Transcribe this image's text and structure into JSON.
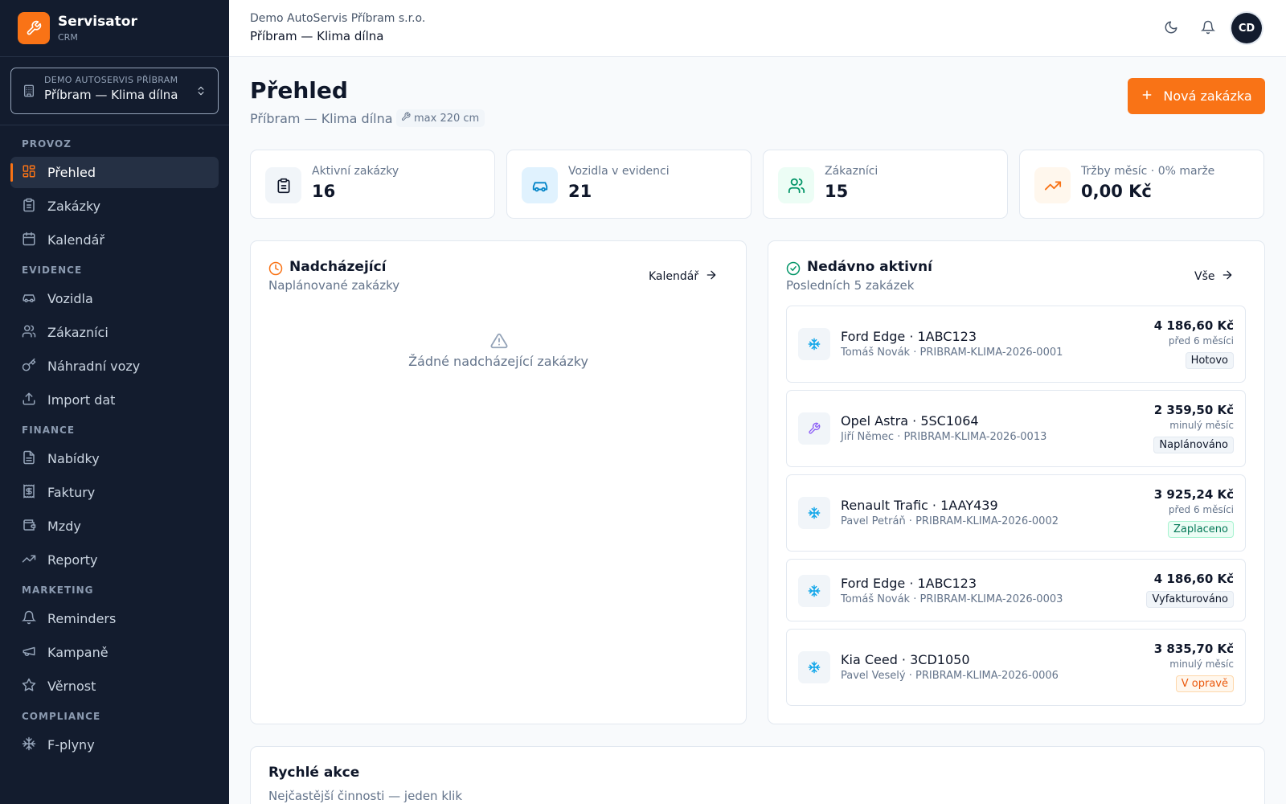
{
  "app": {
    "name": "Servisator",
    "sub": "CRM"
  },
  "tenant": {
    "org": "DEMO AUTOSERVIS PŘÍBRAM",
    "name": "Příbram — Klima dílna"
  },
  "nav": {
    "sections": {
      "provoz": "PROVOZ",
      "evidence": "EVIDENCE",
      "finance": "FINANCE",
      "marketing": "MARKETING",
      "compliance": "COMPLIANCE"
    },
    "items": {
      "prehled": "Přehled",
      "zakazky": "Zakázky",
      "kalendar": "Kalendář",
      "vozidla": "Vozidla",
      "zakaznici": "Zákazníci",
      "nahradni": "Náhradní vozy",
      "import": "Import dat",
      "nabidky": "Nabídky",
      "faktury": "Faktury",
      "mzdy": "Mzdy",
      "reporty": "Reporty",
      "reminders": "Reminders",
      "kampane": "Kampaně",
      "vernost": "Věrnost",
      "fplyny": "F-plyny"
    }
  },
  "topbar": {
    "org": "Demo AutoServis Příbram s.r.o.",
    "location": "Příbram — Klima dílna",
    "avatar": "CD"
  },
  "page": {
    "title": "Přehled",
    "subtitle": "Příbram — Klima dílna",
    "badge": "max 220 cm",
    "new_button": "Nová zakázka"
  },
  "stats": [
    {
      "label": "Aktivní zakázky",
      "value": "16"
    },
    {
      "label": "Vozidla v evidenci",
      "value": "21"
    },
    {
      "label": "Zákazníci",
      "value": "15"
    },
    {
      "label": "Tržby měsíc · 0% marže",
      "value": "0,00 Kč"
    }
  ],
  "upcoming": {
    "title": "Nadcházející",
    "subtitle": "Naplánované zakázky",
    "link": "Kalendář",
    "empty": "Žádné nadcházející zakázky"
  },
  "recent": {
    "title": "Nedávno aktivní",
    "subtitle": "Posledních 5 zakázek",
    "link": "Vše",
    "jobs": [
      {
        "title": "Ford Edge · 1ABC123",
        "sub": "Tomáš Novák · PRIBRAM-KLIMA-2026-0001",
        "price": "4 186,60 Kč",
        "when": "před 6 měsíci",
        "status": "Hotovo",
        "icon": "snowflake-icon"
      },
      {
        "title": "Opel Astra · 5SC1064",
        "sub": "Jiří Němec · PRIBRAM-KLIMA-2026-0013",
        "price": "2 359,50 Kč",
        "when": "minulý měsíc",
        "status": "Naplánováno",
        "icon": "wrench-icon"
      },
      {
        "title": "Renault Trafic · 1AAY439",
        "sub": "Pavel Petráň · PRIBRAM-KLIMA-2026-0002",
        "price": "3 925,24 Kč",
        "when": "před 6 měsíci",
        "status": "Zaplaceno",
        "icon": "snowflake-icon"
      },
      {
        "title": "Ford Edge · 1ABC123",
        "sub": "Tomáš Novák · PRIBRAM-KLIMA-2026-0003",
        "price": "4 186,60 Kč",
        "status": "Vyfakturováno",
        "icon": "snowflake-icon"
      },
      {
        "title": "Kia Ceed · 3CD1050",
        "sub": "Pavel Veselý · PRIBRAM-KLIMA-2026-0006",
        "price": "3 835,70 Kč",
        "when": "minulý měsíc",
        "status": "V opravě",
        "icon": "snowflake-icon"
      }
    ]
  },
  "quick": {
    "title": "Rychlé akce",
    "subtitle": "Nejčastější činnosti — jeden klik"
  },
  "colors": {
    "accent": "#f97316",
    "sidebar": "#131c2e",
    "sidebar_active": "#253044",
    "status_paid": "#047857",
    "status_repair": "#ea580c"
  }
}
